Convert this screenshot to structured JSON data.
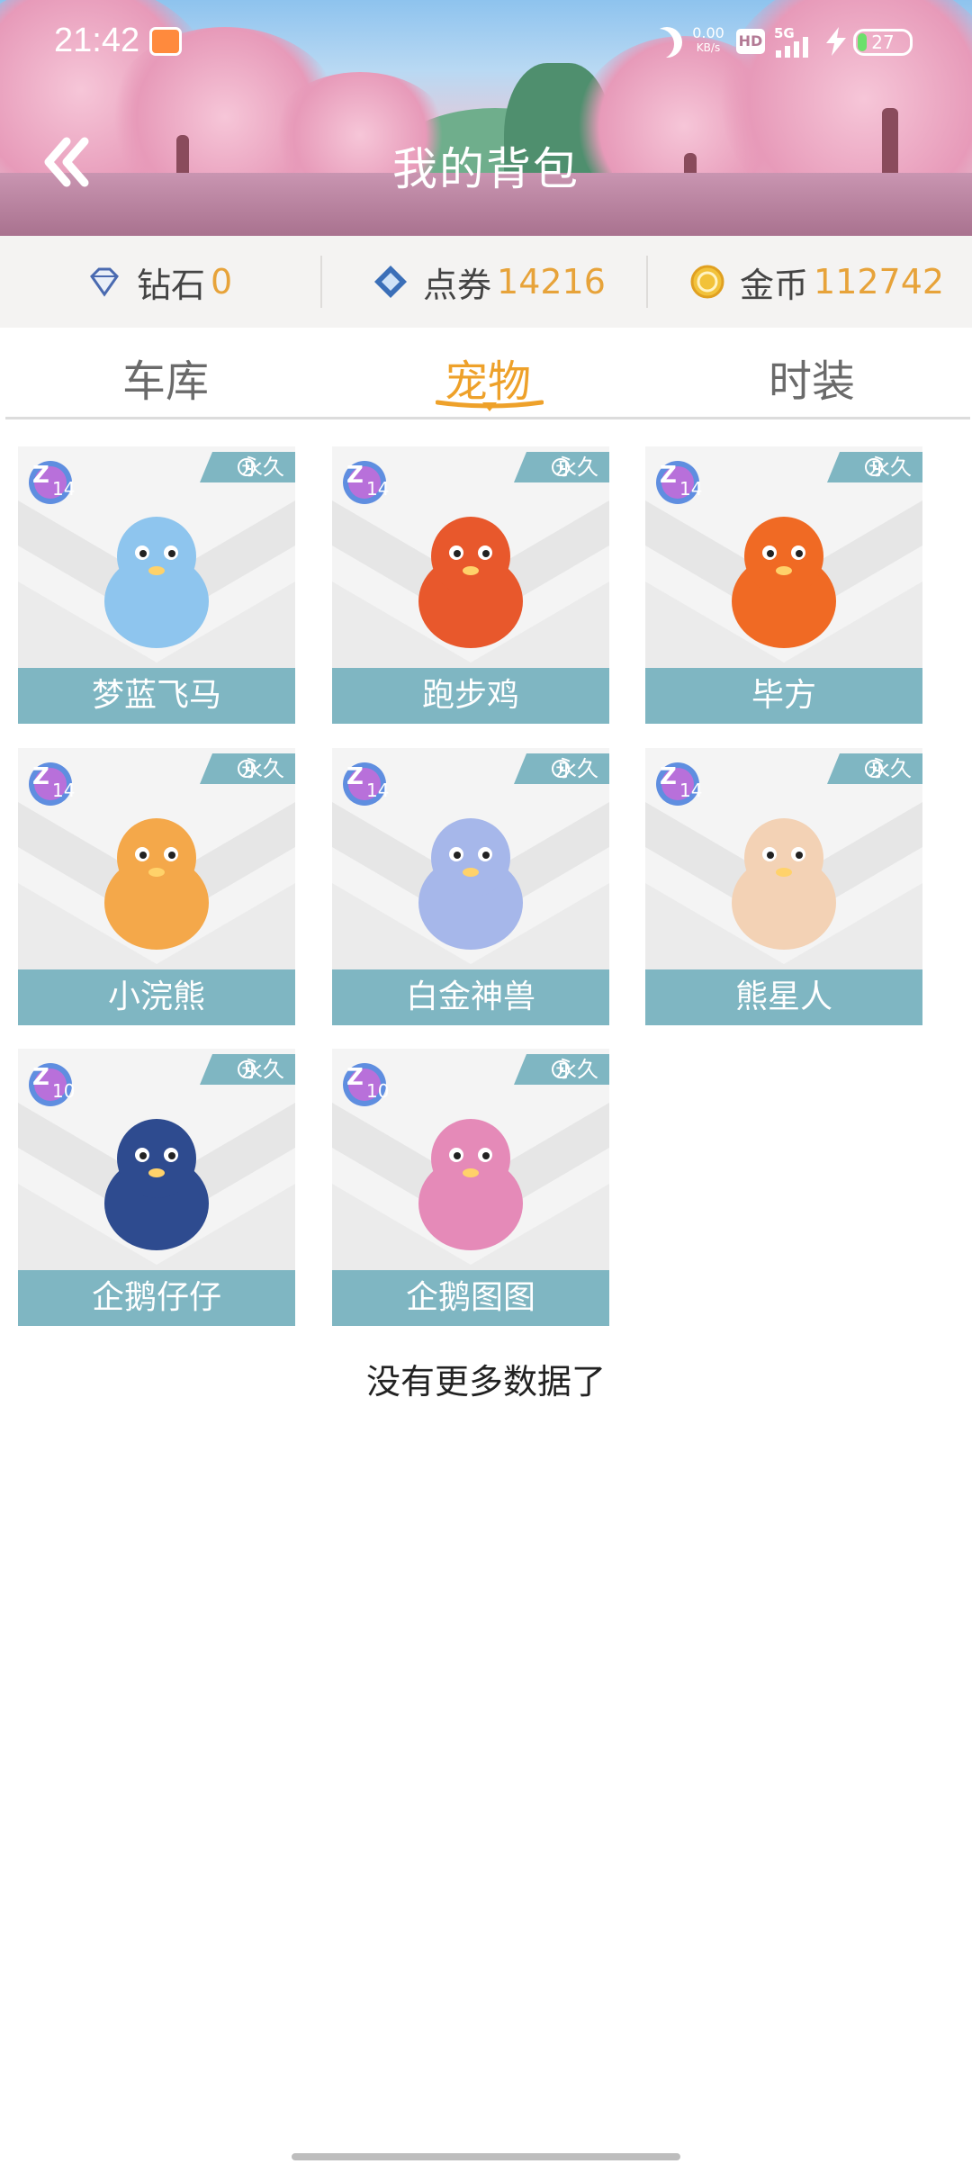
{
  "status_bar": {
    "time": "21:42",
    "netspeed_top": "0.00",
    "netspeed_unit": "KB/s",
    "hd_label": "HD",
    "network_label": "5G",
    "battery": "27"
  },
  "header": {
    "title": "我的背包"
  },
  "currency": {
    "diamond_label": "钻石",
    "diamond_value": "0",
    "coupon_label": "点券",
    "coupon_value": "14216",
    "coin_label": "金币",
    "coin_value": "112742"
  },
  "tabs": [
    {
      "label": "车库",
      "active": false
    },
    {
      "label": "宠物",
      "active": true
    },
    {
      "label": "时装",
      "active": false
    }
  ],
  "pets": [
    {
      "name": "梦蓝飞马",
      "tag": "永久",
      "level": "14",
      "icon": "blue-pegasus-icon",
      "color": "#8ec5ee"
    },
    {
      "name": "跑步鸡",
      "tag": "永久",
      "level": "14",
      "icon": "rooster-icon",
      "color": "#e8582c"
    },
    {
      "name": "毕方",
      "tag": "永久",
      "level": "14",
      "icon": "fire-bird-icon",
      "color": "#f06a24"
    },
    {
      "name": "小浣熊",
      "tag": "永久",
      "level": "14",
      "icon": "raccoon-icon",
      "color": "#f4a84a"
    },
    {
      "name": "白金神兽",
      "tag": "永久",
      "level": "14",
      "icon": "platinum-beast-icon",
      "color": "#a6b7ea"
    },
    {
      "name": "熊星人",
      "tag": "永久",
      "level": "14",
      "icon": "bear-astronaut-icon",
      "color": "#f3d2b5"
    },
    {
      "name": "企鹅仔仔",
      "tag": "永久",
      "level": "10",
      "icon": "blue-penguin-icon",
      "color": "#2e4b8f"
    },
    {
      "name": "企鹅图图",
      "tag": "永久",
      "level": "10",
      "icon": "pink-penguin-icon",
      "color": "#e58ab8"
    }
  ],
  "footer": {
    "no_more": "没有更多数据了"
  },
  "colors": {
    "accent": "#eea12a",
    "card_strip": "#7fb6c2",
    "currency_value": "#e7a33a"
  }
}
